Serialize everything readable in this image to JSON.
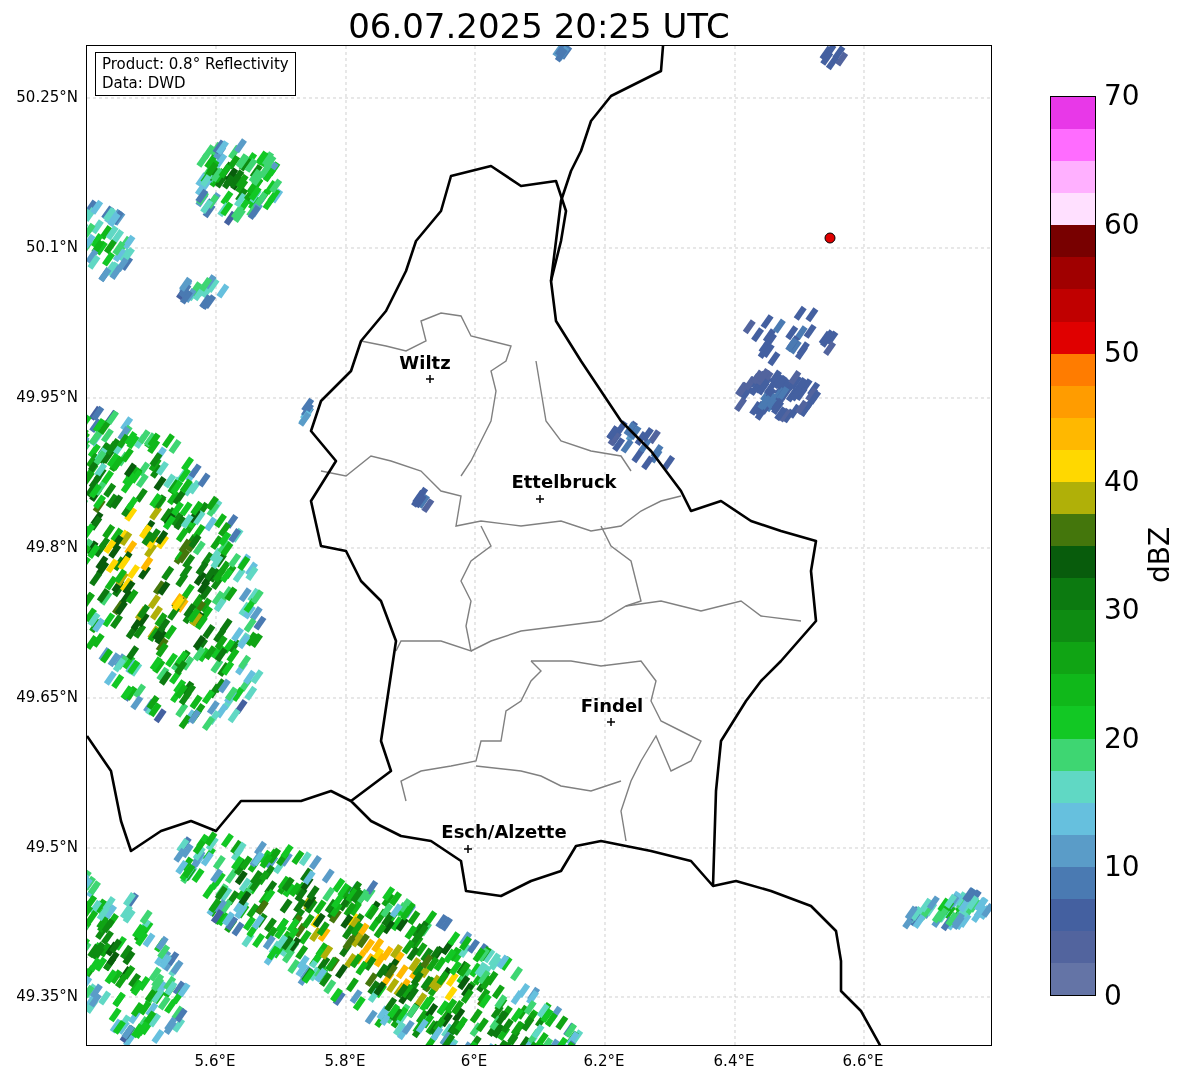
{
  "title": "06.07.2025 20:25 UTC",
  "info_box": {
    "lines": [
      "Product: 0.8° Reflectivity",
      "Data: DWD"
    ]
  },
  "y_ticks": [
    "50.25°N",
    "50.1°N",
    "49.95°N",
    "49.8°N",
    "49.65°N",
    "49.5°N",
    "49.35°N"
  ],
  "x_ticks": [
    "5.6°E",
    "5.8°E",
    "6°E",
    "6.2°E",
    "6.4°E",
    "6.6°E"
  ],
  "cities": [
    {
      "name": "Wiltz"
    },
    {
      "name": "Ettelbruck"
    },
    {
      "name": "Findel"
    },
    {
      "name": "Esch/Alzette"
    }
  ],
  "colorbar": {
    "label": "dBZ",
    "ticks": [
      "70",
      "60",
      "50",
      "40",
      "30",
      "20",
      "10",
      "0"
    ],
    "bands": [
      {
        "color": "#e838e8"
      },
      {
        "color": "#ff6cff"
      },
      {
        "color": "#ffb0ff"
      },
      {
        "color": "#ffe0ff"
      },
      {
        "color": "#780000"
      },
      {
        "color": "#a00000"
      },
      {
        "color": "#c00000"
      },
      {
        "color": "#e00000"
      },
      {
        "color": "#ff7c00"
      },
      {
        "color": "#ff9c00"
      },
      {
        "color": "#ffb800"
      },
      {
        "color": "#ffd800"
      },
      {
        "color": "#b0b008"
      },
      {
        "color": "#44760c"
      },
      {
        "color": "#085c0c"
      },
      {
        "color": "#0c7a10"
      },
      {
        "color": "#0e8c12"
      },
      {
        "color": "#10a414"
      },
      {
        "color": "#10b81a"
      },
      {
        "color": "#12c824"
      },
      {
        "color": "#3ed672"
      },
      {
        "color": "#60d8c4"
      },
      {
        "color": "#66c0de"
      },
      {
        "color": "#5a9cc8"
      },
      {
        "color": "#4a7ab2"
      },
      {
        "color": "#4460a0"
      },
      {
        "color": "#52649e"
      },
      {
        "color": "#6474a6"
      }
    ]
  }
}
